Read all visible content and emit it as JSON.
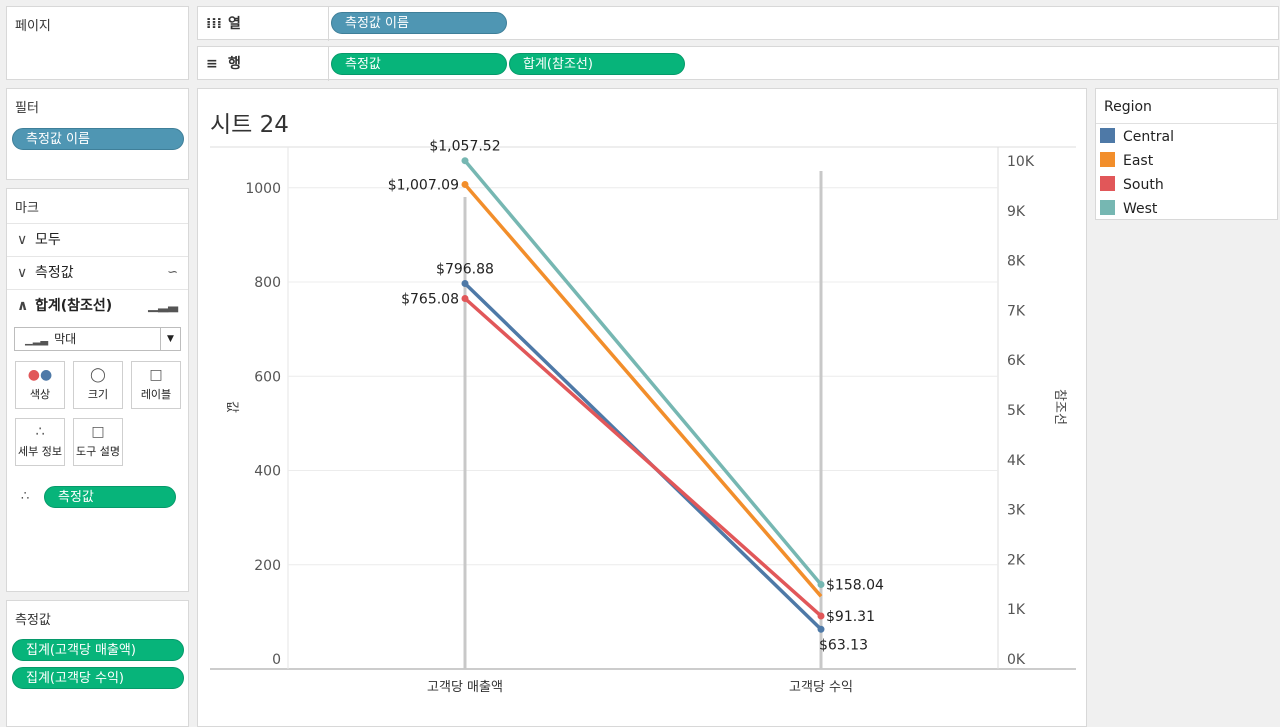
{
  "pages_panel": {
    "title": "페이지"
  },
  "columns_shelf": {
    "label": "열",
    "icon": "columns-icon",
    "pill": "측정값 이름"
  },
  "rows_shelf": {
    "label": "행",
    "icon": "rows-icon",
    "pills": [
      "측정값",
      "합계(참조선)"
    ]
  },
  "filters_panel": {
    "title": "필터",
    "pill": "측정값 이름"
  },
  "marks_panel": {
    "title": "마크",
    "sections": [
      {
        "label": "모두",
        "expanded": false,
        "icon": ""
      },
      {
        "label": "측정값",
        "expanded": false,
        "icon": "line-icon"
      },
      {
        "label": "합계(참조선)",
        "expanded": true,
        "icon": "bar-icon"
      }
    ],
    "mark_type": "막대",
    "buttons": [
      "색상",
      "크기",
      "레이블",
      "세부 정보",
      "도구 설명"
    ],
    "detail_pill": "측정값"
  },
  "measures_panel": {
    "title": "측정값",
    "pills": [
      "집계(고객당 매출액)",
      "집계(고객당 수익)"
    ]
  },
  "sheet": {
    "title": "시트 24"
  },
  "legend": {
    "title": "Region",
    "items": [
      {
        "name": "Central",
        "color": "#4e79a7"
      },
      {
        "name": "East",
        "color": "#f28e2b"
      },
      {
        "name": "South",
        "color": "#e15759"
      },
      {
        "name": "West",
        "color": "#76b7b2"
      }
    ]
  },
  "chart_data": {
    "type": "line",
    "categories": [
      "고객당 매출액",
      "고객당 수익"
    ],
    "ylabel": "값",
    "y2label": "참조선",
    "ylim": [
      0,
      1110
    ],
    "yticks": [
      0,
      200,
      400,
      600,
      800,
      1000
    ],
    "y2ticks": [
      "0K",
      "1K",
      "2K",
      "3K",
      "4K",
      "5K",
      "6K",
      "7K",
      "8K",
      "9K",
      "10K"
    ],
    "series": [
      {
        "name": "Central",
        "values": [
          796.88,
          63.13
        ],
        "labels": [
          "$796.88",
          "$63.13"
        ],
        "color": "#4e79a7"
      },
      {
        "name": "East",
        "values": [
          1007.09,
          133
        ],
        "labels": [
          "$1,007.09",
          ""
        ],
        "color": "#f28e2b"
      },
      {
        "name": "South",
        "values": [
          765.08,
          91.31
        ],
        "labels": [
          "$765.08",
          "$91.31"
        ],
        "color": "#e15759"
      },
      {
        "name": "West",
        "values": [
          1057.52,
          158.04
        ],
        "labels": [
          "$1,057.52",
          "$158.04"
        ],
        "color": "#76b7b2"
      }
    ],
    "grid": true
  }
}
